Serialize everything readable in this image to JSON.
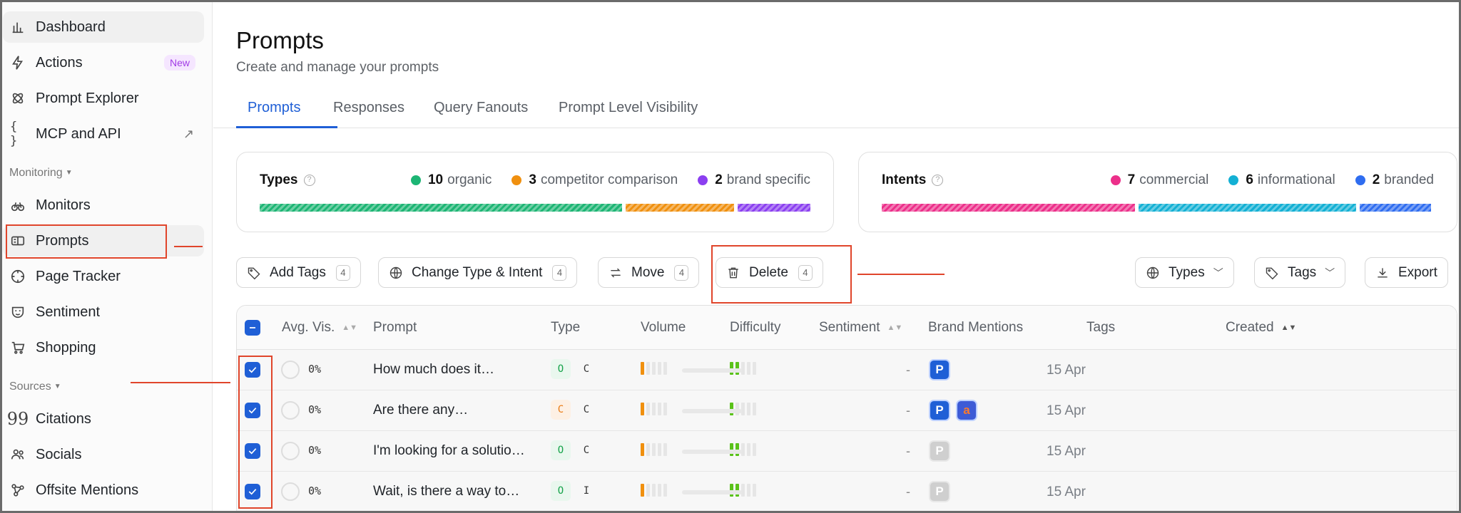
{
  "sidebar": {
    "items": [
      {
        "label": "Dashboard",
        "icon": "bar-chart-icon"
      },
      {
        "label": "Actions",
        "icon": "bolt-icon",
        "badge": "New"
      },
      {
        "label": "Prompt Explorer",
        "icon": "atom-icon"
      },
      {
        "label": "MCP and API",
        "icon": "braces-icon"
      },
      {
        "label": "Monitors",
        "icon": "binoculars-icon"
      },
      {
        "label": "Prompts",
        "icon": "prompts-icon"
      },
      {
        "label": "Page Tracker",
        "icon": "target-icon"
      },
      {
        "label": "Sentiment",
        "icon": "mask-icon"
      },
      {
        "label": "Shopping",
        "icon": "cart-icon"
      },
      {
        "label": "Citations",
        "icon": "quote-icon"
      },
      {
        "label": "Socials",
        "icon": "users-icon"
      },
      {
        "label": "Offsite Mentions",
        "icon": "network-icon"
      }
    ],
    "sections": {
      "monitoring": "Monitoring",
      "sources": "Sources"
    },
    "ext_arrow": "↗"
  },
  "header": {
    "title": "Prompts",
    "subtitle": "Create and manage your prompts"
  },
  "tabs": [
    "Prompts",
    "Responses",
    "Query Fanouts",
    "Prompt Level Visibility"
  ],
  "types_card": {
    "title": "Types",
    "legend": [
      {
        "count": "10",
        "label": "organic",
        "color": "#1db574"
      },
      {
        "count": "3",
        "label": "competitor comparison",
        "color": "#f0900f"
      },
      {
        "count": "2",
        "label": "brand specific",
        "color": "#8b3ff0"
      }
    ]
  },
  "intents_card": {
    "title": "Intents",
    "legend": [
      {
        "count": "7",
        "label": "commercial",
        "color": "#ec2f8a"
      },
      {
        "count": "6",
        "label": "informational",
        "color": "#13b0d4"
      },
      {
        "count": "2",
        "label": "branded",
        "color": "#2f6df0"
      }
    ]
  },
  "toolbar": {
    "add_tags": "Add Tags",
    "change_type": "Change Type & Intent",
    "move": "Move",
    "delete": "Delete",
    "selected_count": "4",
    "types": "Types",
    "tags": "Tags",
    "export": "Export"
  },
  "table": {
    "headers": {
      "avg_vis": "Avg. Vis.",
      "prompt": "Prompt",
      "type": "Type",
      "volume": "Volume",
      "difficulty": "Difficulty",
      "sentiment": "Sentiment",
      "brand_mentions": "Brand Mentions",
      "tags": "Tags",
      "created": "Created"
    },
    "rows": [
      {
        "visibility": "0%",
        "prompt": "How much does it…",
        "type": "O",
        "intent": "C",
        "tags": "-",
        "created": "15 Apr"
      },
      {
        "visibility": "0%",
        "prompt": "Are there any…",
        "type": "C",
        "intent": "C",
        "tags": "-",
        "created": "15 Apr"
      },
      {
        "visibility": "0%",
        "prompt": "I'm looking for a solutio…",
        "type": "O",
        "intent": "C",
        "tags": "-",
        "created": "15 Apr"
      },
      {
        "visibility": "0%",
        "prompt": "Wait, is there a way to…",
        "type": "O",
        "intent": "I",
        "tags": "-",
        "created": "15 Apr"
      }
    ],
    "brand_letters": {
      "p": "P",
      "a": "a"
    }
  }
}
